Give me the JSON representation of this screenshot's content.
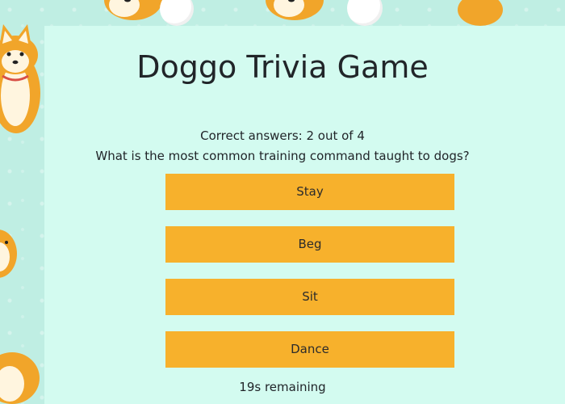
{
  "game": {
    "title": "Doggo Trivia Game",
    "score_text": "Correct answers: 2 out of 4",
    "question": "What is the most common training command taught to dogs?",
    "answers": [
      {
        "label": "Stay"
      },
      {
        "label": "Beg"
      },
      {
        "label": "Sit"
      },
      {
        "label": "Dance"
      }
    ],
    "timer_text": "19s remaining"
  },
  "theme": {
    "background": "#bfeee3",
    "panel": "#d3fbf0",
    "button": "#f7b12c",
    "text": "#212529"
  },
  "icons": {
    "background_pattern": "shiba-dog-pattern"
  }
}
